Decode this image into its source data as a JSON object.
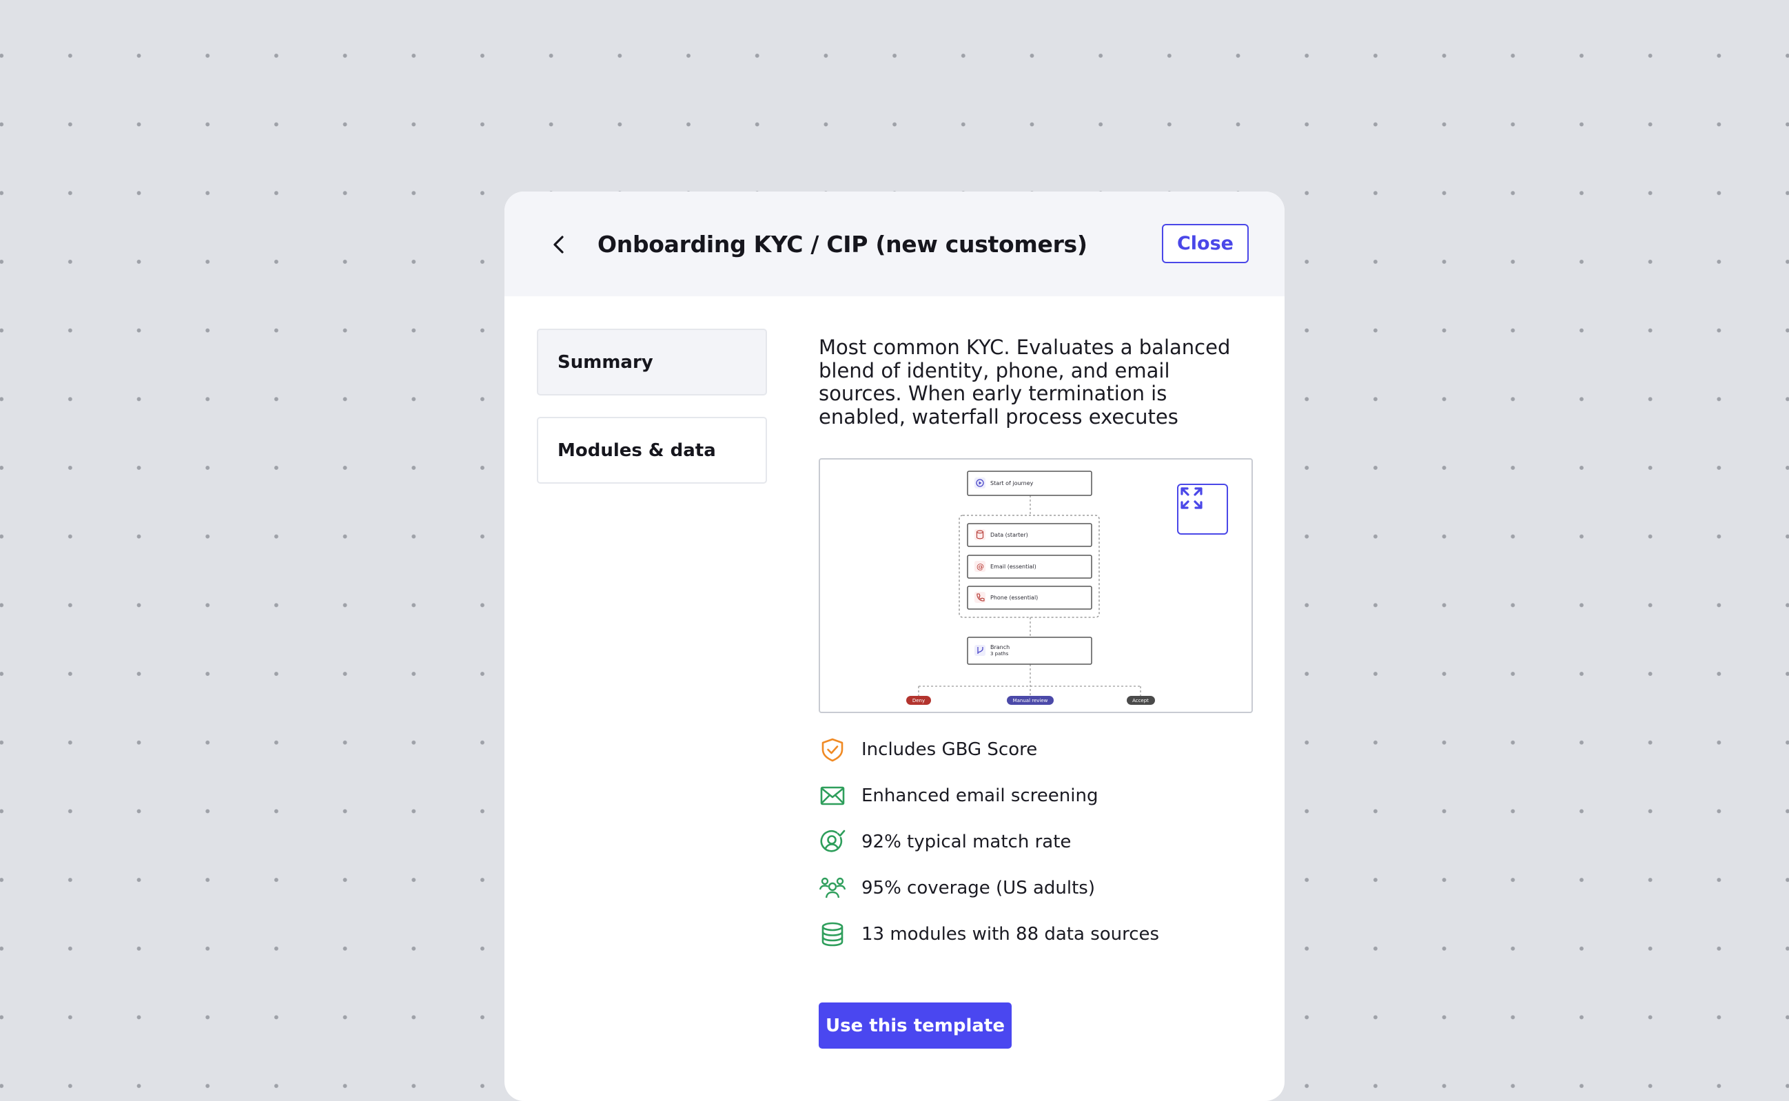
{
  "header": {
    "title": "Onboarding KYC / CIP (new customers)",
    "close_label": "Close",
    "back_icon": "chevron-left-icon"
  },
  "nav": {
    "items": [
      {
        "label": "Summary",
        "active": true
      },
      {
        "label": "Modules & data",
        "active": false
      }
    ]
  },
  "summary": {
    "description": "Most common KYC. Evaluates a balanced blend of identity, phone, and email sources. When early termination is enabled, waterfall process executes"
  },
  "diagram": {
    "expand_icon": "expand-icon",
    "nodes": {
      "start": "Start of journey",
      "data": "Data (starter)",
      "email": "Email (essential)",
      "phone": "Phone (essential)",
      "branch": "Branch",
      "branch_sub": "3 paths"
    },
    "outcomes": {
      "deny": "Deny",
      "manual": "Manual review",
      "accept": "Accept"
    },
    "colors": {
      "deny": "#b3342e",
      "manual": "#4b49a8",
      "accept": "#4a4a4a"
    }
  },
  "features": [
    {
      "icon": "shield-check-icon",
      "label": "Includes GBG Score",
      "color": "#f08a24"
    },
    {
      "icon": "envelope-icon",
      "label": "Enhanced email screening",
      "color": "#2e9e5b"
    },
    {
      "icon": "user-check-icon",
      "label": "92% typical match rate",
      "color": "#2e9e5b"
    },
    {
      "icon": "users-group-icon",
      "label": "95% coverage (US adults)",
      "color": "#2e9e5b"
    },
    {
      "icon": "database-icon",
      "label": "13 modules with 88 data sources",
      "color": "#2e9e5b"
    }
  ],
  "cta": {
    "label": "Use this template"
  },
  "colors": {
    "accent": "#4a47f0",
    "background": "#dfe1e6"
  }
}
